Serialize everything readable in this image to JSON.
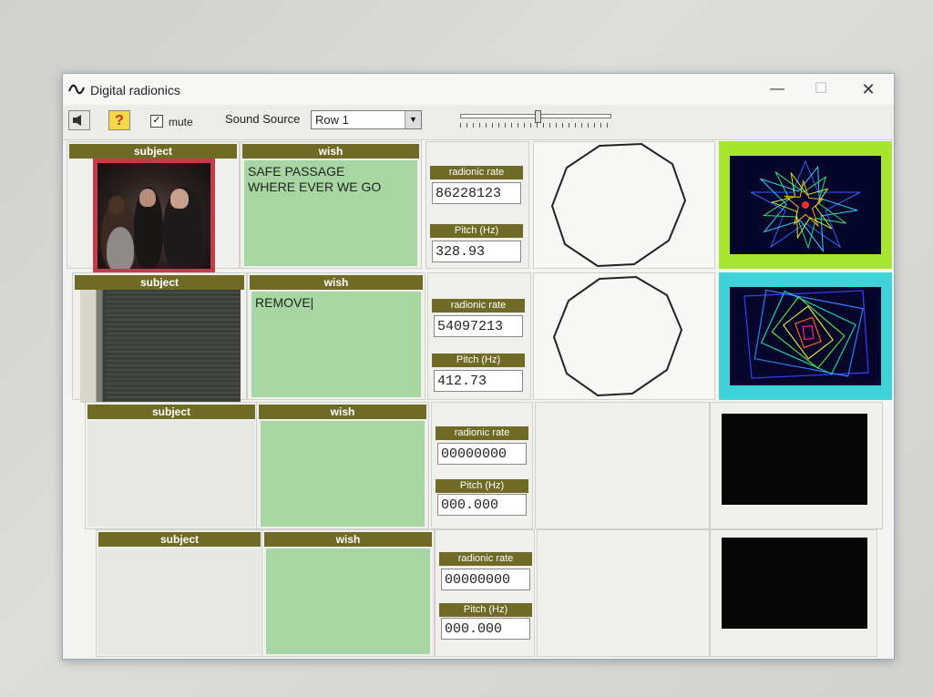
{
  "window": {
    "title": "Digital radionics"
  },
  "toolbar": {
    "mute_label": "mute",
    "mute_checked": "✓",
    "sound_source_label": "Sound Source",
    "sound_source_value": "Row 1"
  },
  "headers": {
    "subject": "subject",
    "wish": "wish",
    "rate": "radionic rate",
    "pitch": "Pitch (Hz)"
  },
  "rows": [
    {
      "wish_lines": [
        "SAFE PASSAGE",
        "WHERE EVER WE GO"
      ],
      "rate": "86228123",
      "pitch": "328.93",
      "frame_color": "#a6e62c"
    },
    {
      "wish_lines": [
        "REMOVE|"
      ],
      "rate": "54097213",
      "pitch": "412.73",
      "frame_color": "#3fd2d8"
    },
    {
      "wish_lines": [],
      "rate": "00000000",
      "pitch": "000.000",
      "frame_color": "#e9e9e6"
    },
    {
      "wish_lines": [],
      "rate": "00000000",
      "pitch": "000.000",
      "frame_color": "#e9e9e6"
    }
  ]
}
